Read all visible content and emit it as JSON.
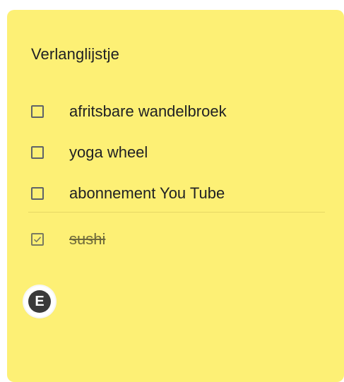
{
  "note": {
    "title": "Verlanglijstje",
    "background_color": "#fdf075",
    "unchecked_items": [
      {
        "label": "afritsbare wandelbroek"
      },
      {
        "label": "yoga wheel"
      },
      {
        "label": "abonnement You Tube"
      }
    ],
    "checked_items": [
      {
        "label": "sushi"
      }
    ],
    "collaborator": {
      "initial": "E"
    }
  }
}
